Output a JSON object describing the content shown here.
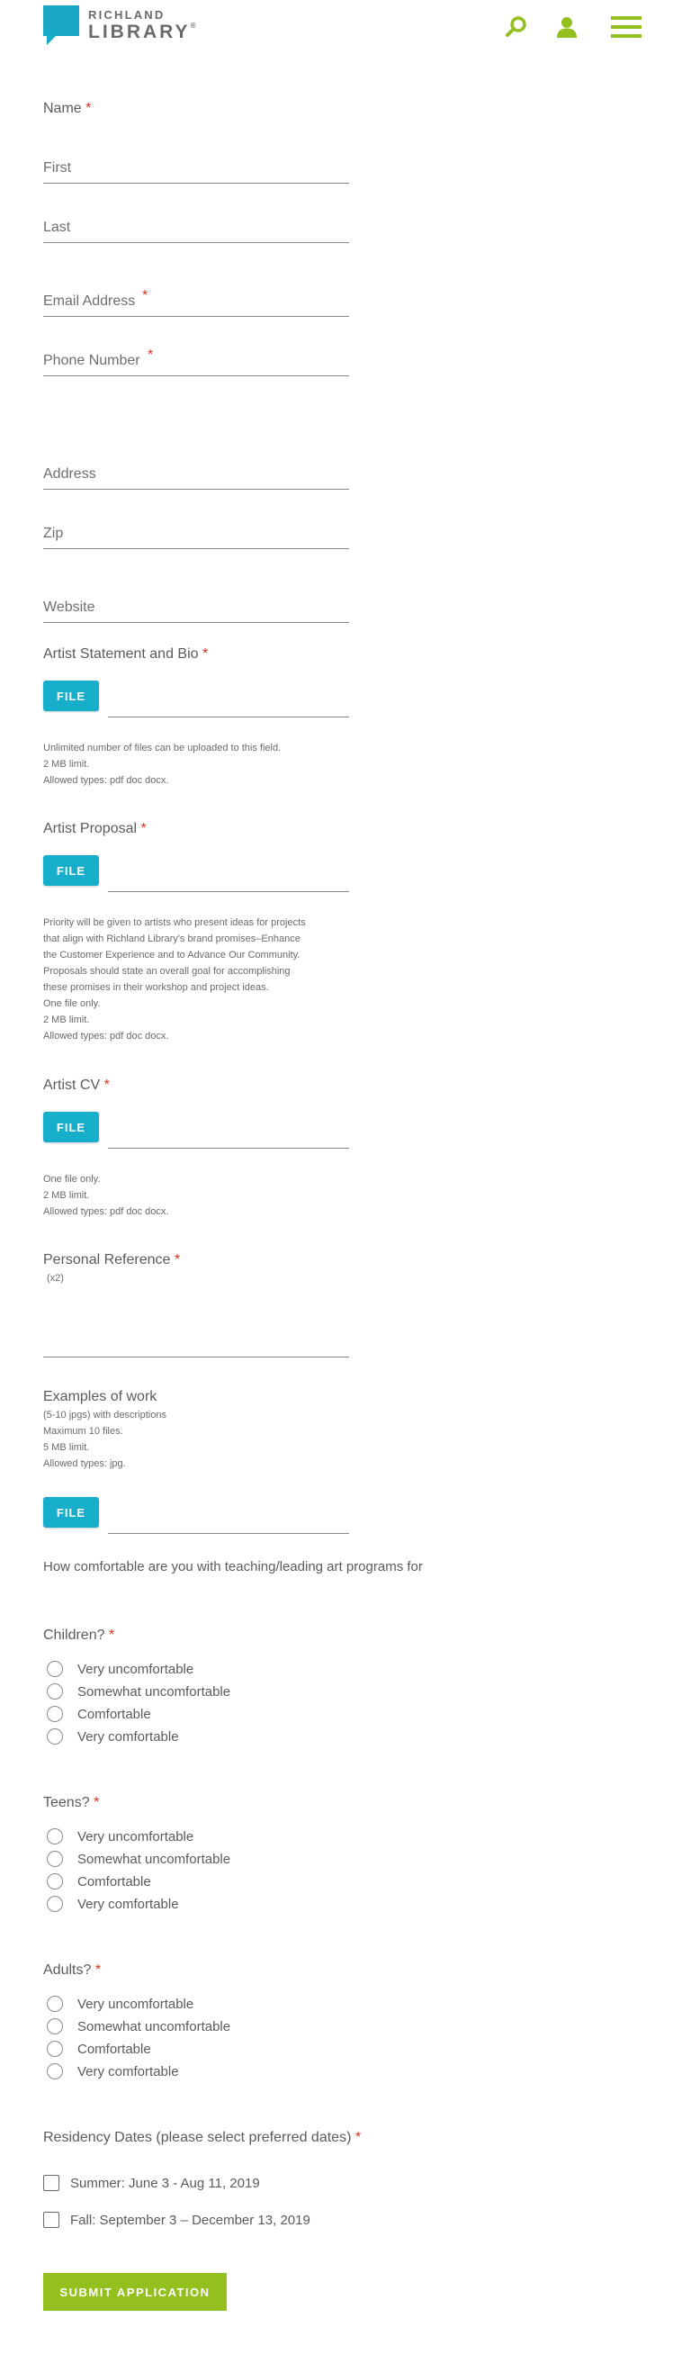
{
  "header": {
    "logo_line1": "RICHLAND",
    "logo_line2": "LIBRARY",
    "logo_tm": "®",
    "icons": [
      "search-icon",
      "user-icon",
      "menu-icon"
    ]
  },
  "colors": {
    "brand_blue": "#17aecb",
    "accent_green": "#93c01f",
    "required": "#e0301e"
  },
  "form": {
    "name": {
      "label": "Name",
      "first_placeholder": "First",
      "last_placeholder": "Last"
    },
    "email": {
      "placeholder": "Email Address"
    },
    "phone": {
      "placeholder": "Phone Number"
    },
    "address": {
      "placeholder": "Address"
    },
    "zip": {
      "placeholder": "Zip"
    },
    "website": {
      "placeholder": "Website"
    },
    "required_mark": "*",
    "statement": {
      "label": "Artist Statement and Bio",
      "button": "FILE",
      "help": [
        "Unlimited number of files can be uploaded to this field.",
        "2 MB limit.",
        "Allowed types: pdf doc docx."
      ]
    },
    "proposal": {
      "label": "Artist Proposal",
      "button": "FILE",
      "help": [
        "Priority will be given to artists who present ideas for projects",
        "that align with Richland Library's brand promises–Enhance",
        "the Customer Experience and to Advance Our Community.",
        "Proposals should state an overall goal for accomplishing",
        "these promises in their workshop and project ideas.",
        "One file only.",
        "2 MB limit.",
        "Allowed types: pdf doc docx."
      ]
    },
    "cv": {
      "label": "Artist CV",
      "button": "FILE",
      "help": [
        "One file only.",
        "2 MB limit.",
        "Allowed types: pdf doc docx."
      ]
    },
    "reference": {
      "label": "Personal Reference",
      "note": "(x2)"
    },
    "examples": {
      "label": "Examples of work",
      "help": [
        "(5-10 jpgs) with descriptions",
        "Maximum 10 files.",
        "5 MB limit.",
        "Allowed types: jpg."
      ],
      "button": "FILE"
    },
    "comfort_intro": "How comfortable are you with teaching/leading art programs for",
    "comfort_options": [
      "Very uncomfortable",
      "Somewhat uncomfortable",
      "Comfortable",
      "Very comfortable"
    ],
    "children": {
      "label": "Children?"
    },
    "teens": {
      "label": "Teens?"
    },
    "adults": {
      "label": "Adults?"
    },
    "residency": {
      "label": "Residency Dates (please select preferred dates)",
      "options": [
        "Summer: June 3 - Aug 11, 2019",
        "Fall: September 3 – December 13, 2019"
      ]
    },
    "submit": "SUBMIT APPLICATION"
  }
}
